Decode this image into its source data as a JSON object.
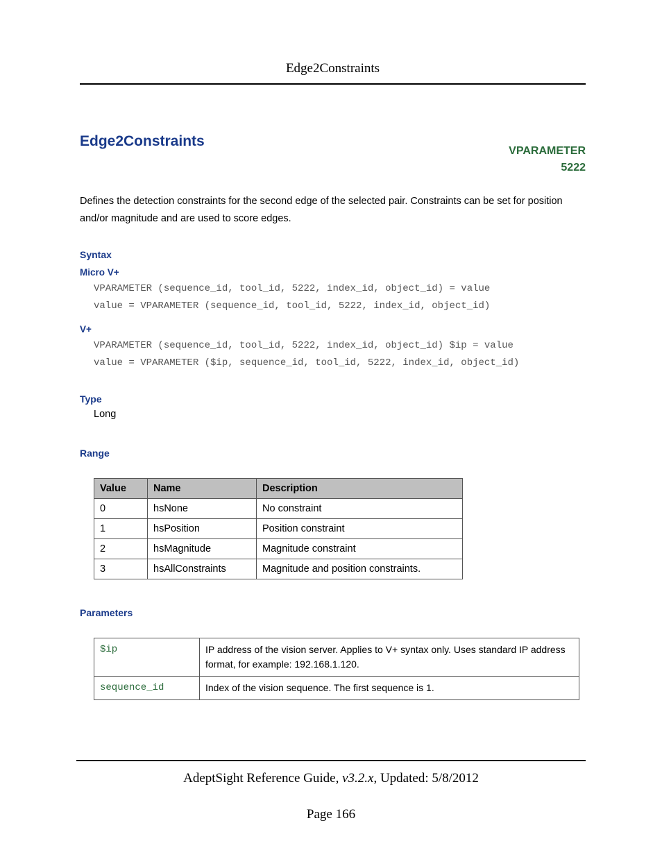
{
  "running_head": "Edge2Constraints",
  "title": "Edge2Constraints",
  "vparam_label": "VPARAMETER",
  "vparam_num": "5222",
  "intro": "Defines the detection constraints for the second edge of the selected pair. Constraints can be set for position and/or magnitude and are used to score edges.",
  "syntax_heading": "Syntax",
  "micro_heading": "Micro V+",
  "micro_code": "VPARAMETER (sequence_id, tool_id, 5222, index_id, object_id) = value\nvalue = VPARAMETER (sequence_id, tool_id, 5222, index_id, object_id)",
  "vplus_heading": "V+",
  "vplus_code": "VPARAMETER (sequence_id, tool_id, 5222, index_id, object_id) $ip = value\nvalue = VPARAMETER ($ip, sequence_id, tool_id, 5222, index_id, object_id)",
  "type_heading": "Type",
  "type_value": "Long",
  "range_heading": "Range",
  "range_headers": {
    "value": "Value",
    "name": "Name",
    "desc": "Description"
  },
  "range_rows": [
    {
      "value": "0",
      "name": "hsNone",
      "desc": "No constraint"
    },
    {
      "value": "1",
      "name": "hsPosition",
      "desc": "Position constraint"
    },
    {
      "value": "2",
      "name": "hsMagnitude",
      "desc": "Magnitude constraint"
    },
    {
      "value": "3",
      "name": "hsAllConstraints",
      "desc": "Magnitude and position constraints."
    }
  ],
  "params_heading": "Parameters",
  "params_rows": [
    {
      "name": "$ip",
      "desc": "IP address of the vision server. Applies to V+ syntax only. Uses standard IP address format, for example: 192.168.1.120."
    },
    {
      "name": "sequence_id",
      "desc": "Index of the vision sequence. The first sequence is 1."
    }
  ],
  "footer_title": "AdeptSight Reference Guide",
  "footer_version": ", v3.2.x",
  "footer_updated": ", Updated: 5/8/2012",
  "page_number": "Page 166",
  "range_col_widths": {
    "value": "60px",
    "name": "140px",
    "desc": "280px"
  }
}
